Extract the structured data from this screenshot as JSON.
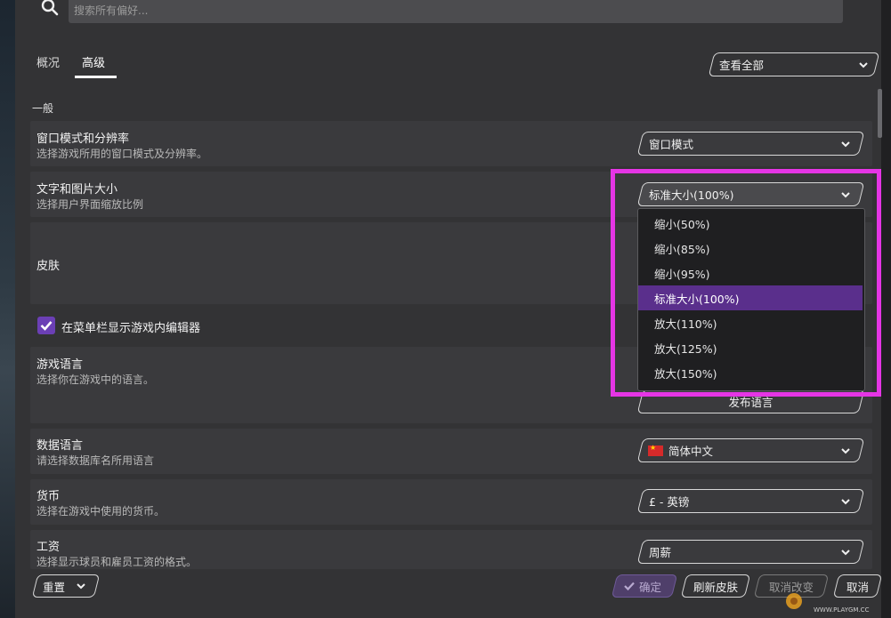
{
  "search": {
    "placeholder": "搜索所有偏好..."
  },
  "tabs": [
    {
      "label": "概况"
    },
    {
      "label": "高级"
    }
  ],
  "view_all": {
    "label": "查看全部"
  },
  "section": {
    "label": "一般"
  },
  "settings": {
    "window_mode": {
      "title": "窗口模式和分辨率",
      "desc": "选择游戏所用的窗口模式及分辨率。",
      "value": "窗口模式"
    },
    "text_size": {
      "title": "文字和图片大小",
      "desc": "选择用户界面缩放比例",
      "value": "标准大小(100%)"
    },
    "skin": {
      "title": "皮肤"
    },
    "editor_checkbox": {
      "label": "在菜单栏显示游戏内编辑器",
      "checked": true
    },
    "game_language": {
      "title": "游戏语言",
      "desc": "选择你在游戏中的语言。",
      "publish_button": "发布语言"
    },
    "data_language": {
      "title": "数据语言",
      "desc": "请选择数据库名所用语言",
      "value": "简体中文"
    },
    "currency": {
      "title": "货币",
      "desc": "选择在游戏中使用的货币。",
      "value": "£ - 英镑"
    },
    "wage": {
      "title": "工资",
      "desc": "选择显示球员和雇员工资的格式。",
      "value": "周薪"
    }
  },
  "dropdown_options": [
    "缩小(50%)",
    "缩小(85%)",
    "缩小(95%)",
    "标准大小(100%)",
    "放大(110%)",
    "放大(125%)",
    "放大(150%)"
  ],
  "dropdown_selected_index": 3,
  "footer": {
    "reset": "重置",
    "confirm": "确定",
    "refresh_skin": "刷新皮肤",
    "cancel_changes": "取消改变",
    "cancel": "取消"
  },
  "watermark": {
    "text": "WWW.PLAYGM.CC"
  },
  "colors": {
    "accent": "#6b3fb5",
    "highlight": "#e535e5",
    "selected_option": "#5a2f8c"
  },
  "icons": [
    "search-icon",
    "chevron-down-icon",
    "check-icon",
    "china-flag-icon"
  ]
}
